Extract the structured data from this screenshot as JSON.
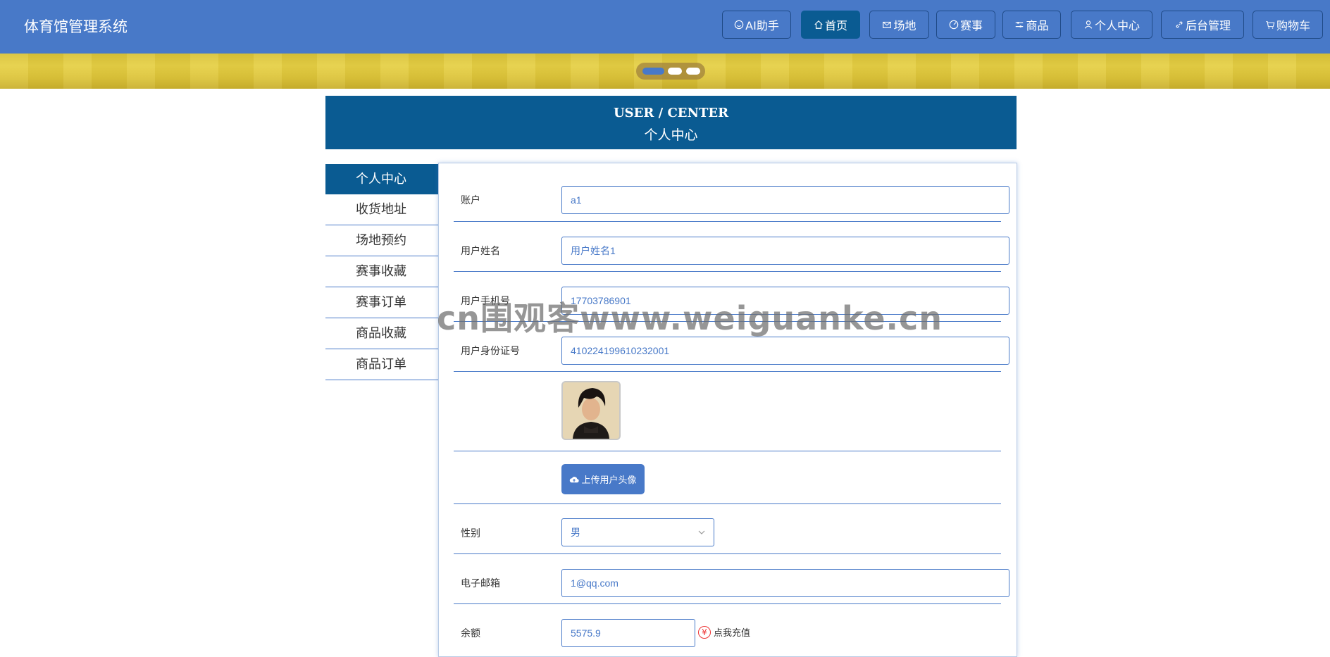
{
  "app": {
    "title": "体育馆管理系统"
  },
  "nav": {
    "items": [
      {
        "label": "AI助手",
        "icon": "smile-icon",
        "active": false
      },
      {
        "label": "首页",
        "icon": "home-icon",
        "active": true
      },
      {
        "label": "场地",
        "icon": "mail-icon",
        "active": false
      },
      {
        "label": "赛事",
        "icon": "gauge-icon",
        "active": false
      },
      {
        "label": "商品",
        "icon": "sliders-icon",
        "active": false
      },
      {
        "label": "个人中心",
        "icon": "user-icon",
        "active": false
      },
      {
        "label": "后台管理",
        "icon": "link-icon",
        "active": false
      },
      {
        "label": "购物车",
        "icon": "cart-icon",
        "active": false
      }
    ]
  },
  "carousel": {
    "slide_count": 3,
    "active_index": 0
  },
  "section": {
    "title_en": "USER / CENTER",
    "title_cn": "个人中心"
  },
  "side_menu": {
    "items": [
      {
        "label": "个人中心",
        "active": true
      },
      {
        "label": "收货地址",
        "active": false
      },
      {
        "label": "场地预约",
        "active": false
      },
      {
        "label": "赛事收藏",
        "active": false
      },
      {
        "label": "赛事订单",
        "active": false
      },
      {
        "label": "商品收藏",
        "active": false
      },
      {
        "label": "商品订单",
        "active": false
      }
    ]
  },
  "form": {
    "account": {
      "label": "账户",
      "value": "a1"
    },
    "name": {
      "label": "用户姓名",
      "value": "用户姓名1"
    },
    "phone": {
      "label": "用户手机号",
      "value": "17703786901"
    },
    "id_card": {
      "label": "用户身份证号",
      "value": "410224199610232001"
    },
    "upload_label": "上传用户头像",
    "gender": {
      "label": "性别",
      "value": "男"
    },
    "email": {
      "label": "电子邮箱",
      "value": "1@qq.com"
    },
    "balance": {
      "label": "余额",
      "value": "5575.9",
      "recharge_label": "点我充值"
    }
  },
  "colors": {
    "nav_bg": "#4879c8",
    "active_bg": "#0a5b92",
    "border": "#4879c8",
    "recharge_icon": "#e33333"
  },
  "watermark": "cn围观客www.weiguanke.cn"
}
